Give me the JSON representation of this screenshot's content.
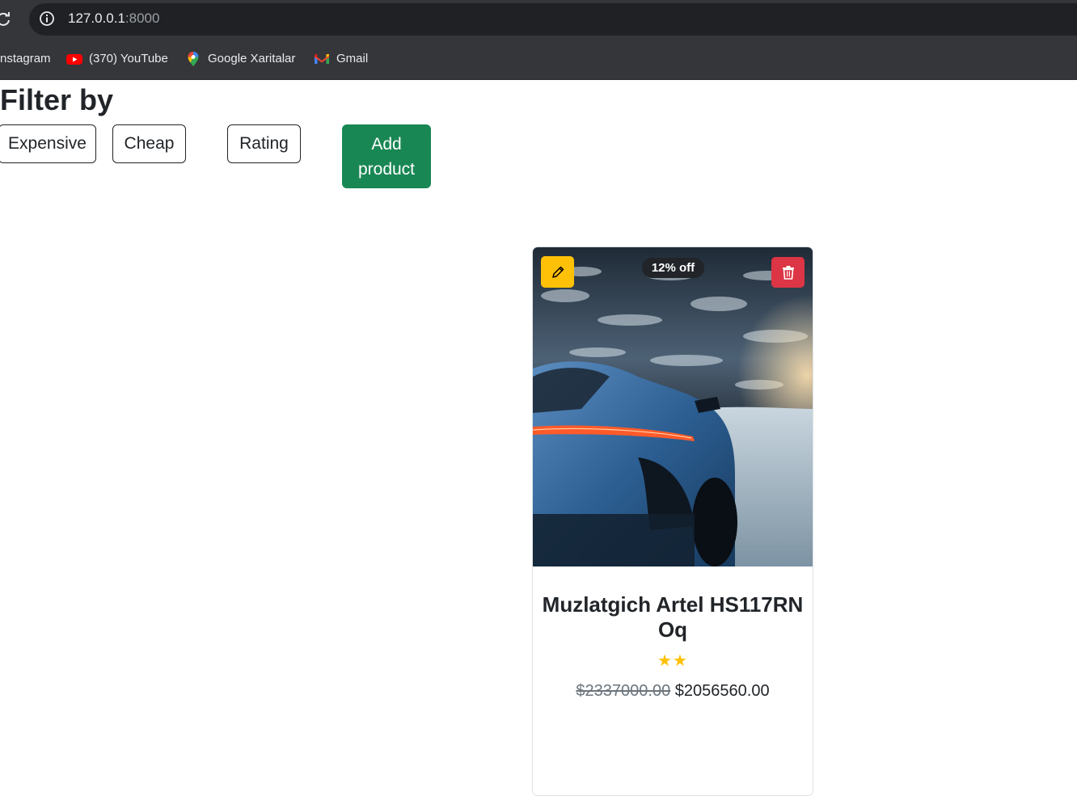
{
  "browser": {
    "url_host": "127.0.0.1",
    "url_port": ":8000",
    "bookmarks": [
      {
        "label": "nstagram",
        "icon": "instagram-icon"
      },
      {
        "label": "(370) YouTube",
        "icon": "youtube-icon"
      },
      {
        "label": "Google Xaritalar",
        "icon": "google-maps-icon"
      },
      {
        "label": "Gmail",
        "icon": "gmail-icon"
      }
    ]
  },
  "filter": {
    "title": "Filter by",
    "buttons": [
      "Expensive",
      "Cheap",
      "Rating"
    ],
    "add_button": "Add product"
  },
  "product": {
    "discount_badge": "12% off",
    "name": "Muzlatgich Artel HS117RN Oq",
    "rating_stars": 2,
    "stars_text": "★★",
    "old_price": "$2337000.00",
    "new_price": "$2056560.00",
    "image": "blue-sports-car-in-snow"
  },
  "colors": {
    "add": "#198754",
    "edit": "#ffc107",
    "delete": "#dc3545",
    "badge": "#212529",
    "star": "#ffc107"
  }
}
